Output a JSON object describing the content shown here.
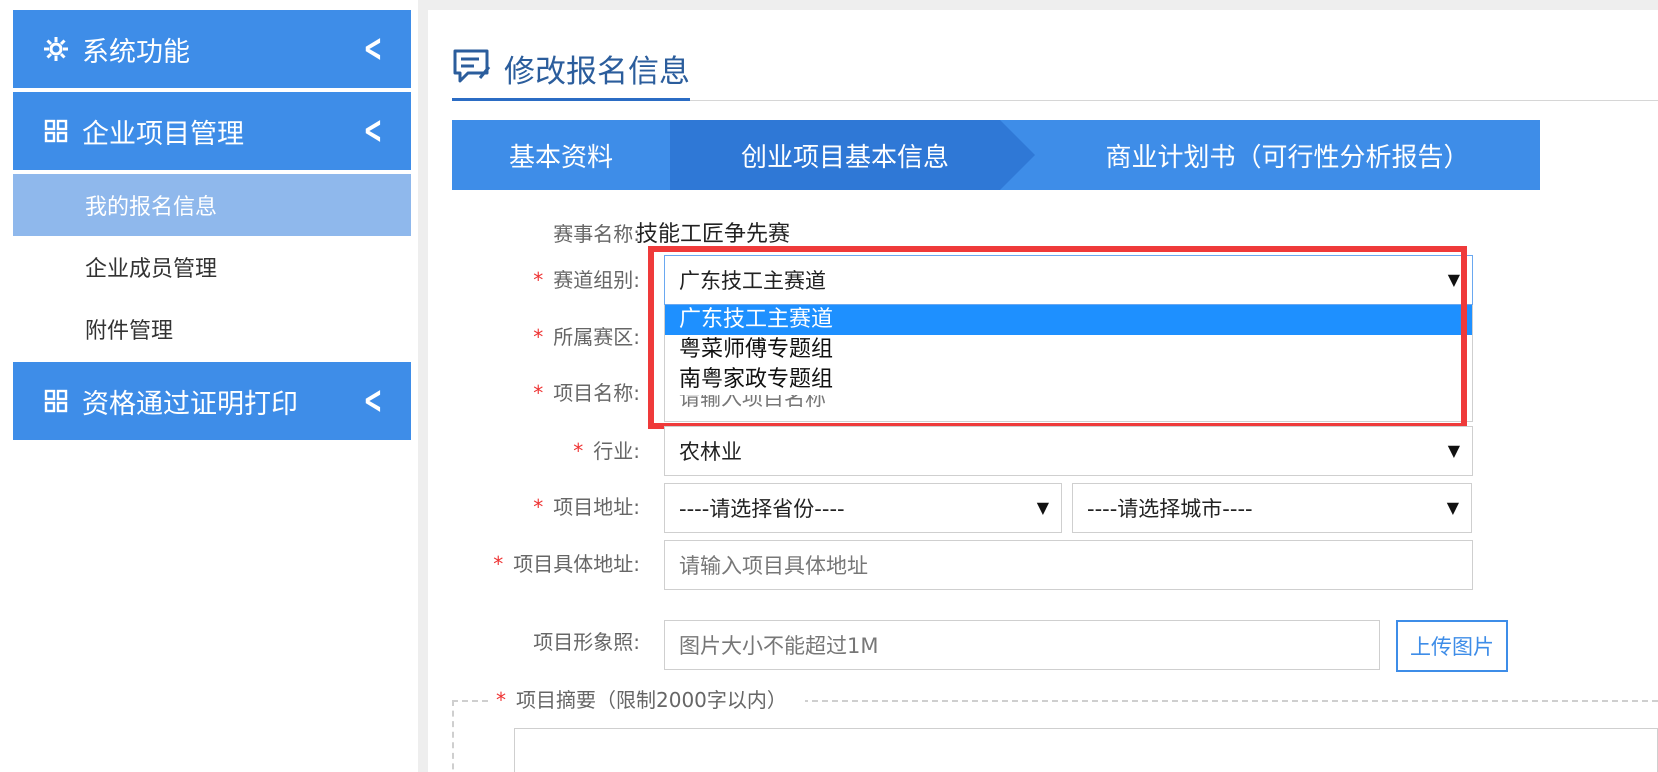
{
  "sidebar": {
    "groups": [
      {
        "label": "系统功能",
        "icon": "gear-icon"
      },
      {
        "label": "企业项目管理",
        "icon": "grid-icon"
      },
      {
        "label": "资格通过证明打印",
        "icon": "grid-icon"
      }
    ],
    "items": [
      {
        "label": "我的报名信息",
        "active": true
      },
      {
        "label": "企业成员管理",
        "active": false
      },
      {
        "label": "附件管理",
        "active": false
      }
    ]
  },
  "page": {
    "title": "修改报名信息",
    "title_icon": "form-edit-icon"
  },
  "steps": [
    {
      "label": "基本资料"
    },
    {
      "label": "创业项目基本信息"
    },
    {
      "label": "商业计划书（可行性分析报告）"
    }
  ],
  "form": {
    "event_name": {
      "label": "赛事名称:",
      "value": "技能工匠争先赛"
    },
    "track": {
      "label": "赛道组别:",
      "value": "广东技工主赛道"
    },
    "region": {
      "label": "所属赛区:"
    },
    "project_name": {
      "label": "项目名称:",
      "placeholder": "请输入项目名称"
    },
    "industry": {
      "label": "行业:",
      "value": "农林业"
    },
    "address": {
      "label": "项目地址:",
      "province": "----请选择省份----",
      "city": "----请选择城市----"
    },
    "detail_address": {
      "label": "项目具体地址:",
      "placeholder": "请输入项目具体地址"
    },
    "image": {
      "label": "项目形象照:",
      "placeholder": "图片大小不能超过1M",
      "button": "上传图片"
    },
    "summary": {
      "label": "项目摘要（限制2000字以内）"
    }
  },
  "dropdown_options": [
    "广东技工主赛道",
    "粤菜师傅专题组",
    "南粤家政专题组"
  ],
  "colors": {
    "primary": "#3e8de8",
    "active_step": "#2f78d6",
    "highlight": "#ef3a3a",
    "selected_option": "#1e90ff"
  }
}
